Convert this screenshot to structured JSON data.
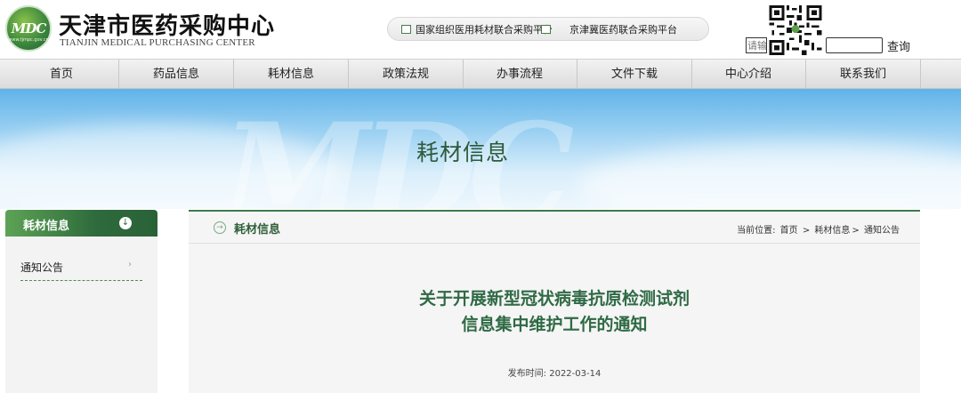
{
  "header": {
    "logo_mark_text": "MDC",
    "logo_mark_url_text": "www.tjmpc.gov.cn",
    "logo_cn": "天津市医药采购中心",
    "logo_en": "TIANJIN MEDICAL PURCHASING CENTER",
    "platforms": [
      {
        "label": "国家组织医用耗材联合采购平台"
      },
      {
        "label": "京津冀医药联合采购平台"
      }
    ],
    "search": {
      "placeholder": "请输",
      "button": "查询"
    }
  },
  "nav": {
    "items": [
      {
        "label": "首页"
      },
      {
        "label": "药品信息"
      },
      {
        "label": "耗材信息"
      },
      {
        "label": "政策法规"
      },
      {
        "label": "办事流程"
      },
      {
        "label": "文件下载"
      },
      {
        "label": "中心介绍"
      },
      {
        "label": "联系我们"
      }
    ]
  },
  "banner": {
    "watermark": "MDC",
    "title": "耗材信息"
  },
  "sidebar": {
    "heading": "耗材信息",
    "heading_icon": "arrow-down-circle-icon",
    "items": [
      {
        "label": "通知公告",
        "arrow": "›"
      }
    ]
  },
  "main": {
    "heading": "耗材信息",
    "heading_icon": "arrow-right-circle-icon",
    "breadcrumb": {
      "prefix": "当前位置:",
      "items": [
        "首页",
        "耗材信息",
        "通知公告"
      ],
      "sep1": ">",
      "sep2": ">"
    },
    "article": {
      "title_line1": "关于开展新型冠状病毒抗原检测试剂",
      "title_line2": "信息集中维护工作的通知",
      "date_label": "发布时间:",
      "date": "2022-03-14"
    }
  },
  "colors": {
    "brand_green": "#2e6a3b",
    "title_green": "#2f6a45",
    "banner_blue": "#5fb3e9"
  }
}
